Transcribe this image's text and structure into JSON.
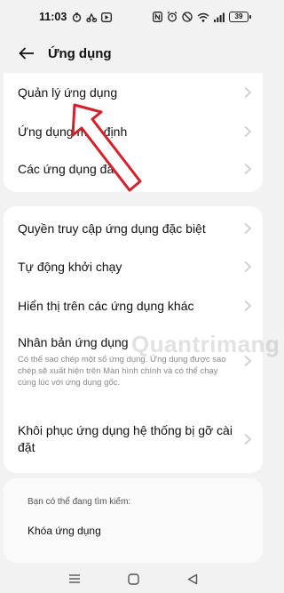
{
  "status": {
    "time": "11:03",
    "battery": "39"
  },
  "header": {
    "title": "Ứng dụng"
  },
  "groups": [
    {
      "items": [
        {
          "label": "Quản lý ứng dụng"
        },
        {
          "label": "Ứng dụng mặc định"
        },
        {
          "label": "Các ứng dụng đã tắt"
        }
      ]
    },
    {
      "items": [
        {
          "label": "Quyền truy cập ứng dụng đặc biệt"
        },
        {
          "label": "Tự động khởi chạy"
        },
        {
          "label": "Hiển thị trên các ứng dụng khác"
        },
        {
          "label": "Nhân bản ứng dụng",
          "description": "Có thể sao chép một số ứng dụng. Ứng dụng được sao chép sẽ xuất hiện trên Màn hình chính và có thể chạy cùng lúc với ứng dụng gốc."
        },
        {
          "label": "Khôi phục ứng dụng hệ thống bị gỡ cài đặt"
        }
      ]
    }
  ],
  "suggestions": {
    "heading": "Bạn có thể đang tìm kiếm:",
    "items": [
      {
        "label": "Khóa ứng dụng"
      }
    ]
  },
  "watermark": "Quantrimang",
  "colors": {
    "background": "#f2f2f2",
    "card": "#ffffff",
    "arrow": "#d4202a",
    "chevron": "#c4c4c4"
  }
}
